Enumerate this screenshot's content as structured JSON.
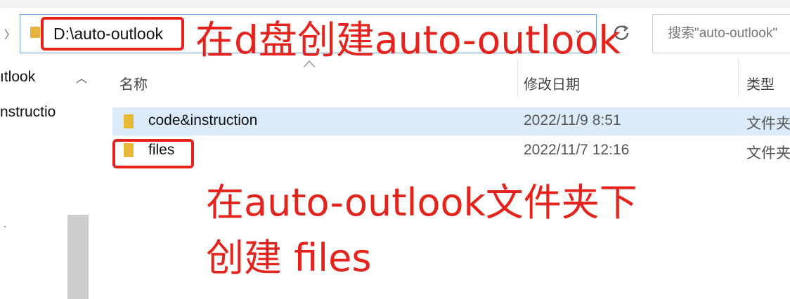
{
  "address_bar": {
    "path": "D:\\auto-outlook",
    "search_placeholder": "搜索\"auto-outlook\""
  },
  "nav_pane": {
    "items": [
      {
        "label": "ıtlook"
      },
      {
        "label": "nstructio"
      }
    ]
  },
  "file_list": {
    "columns": {
      "name": "名称",
      "date": "修改日期",
      "type": "类型"
    },
    "rows": [
      {
        "name": "code&instruction",
        "modified": "2022/11/9 8:51",
        "type": "文件夹",
        "selected": true
      },
      {
        "name": "files",
        "modified": "2022/11/7 12:16",
        "type": "文件夹",
        "selected": false
      }
    ]
  },
  "annotations": {
    "line1": "在d盘创建auto-outlook",
    "line2": "在auto-outlook文件夹下",
    "line3": "创建 files"
  },
  "colors": {
    "annotation_red": "#e5231c",
    "folder_yellow": "#e8b938",
    "selection_blue": "#dcebf9"
  },
  "icons": [
    "back-chevron-icon",
    "folder-icon",
    "chevron-down-icon",
    "refresh-icon",
    "scroll-up-icon",
    "sort-caret-icon"
  ]
}
